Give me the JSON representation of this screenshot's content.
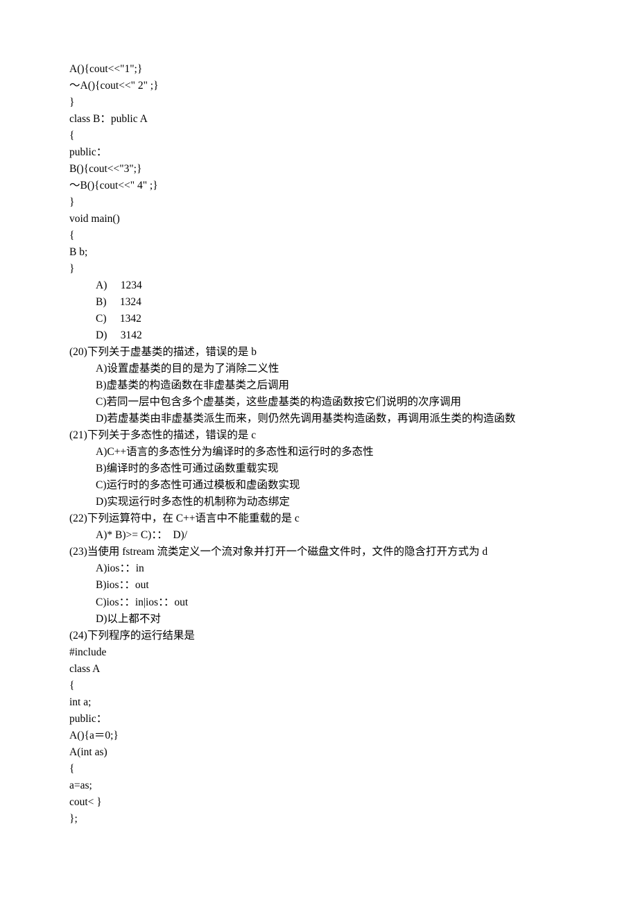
{
  "lines": [
    {
      "cls": "line",
      "t": "A(){cout<<\"1\";}"
    },
    {
      "cls": "line",
      "t": "～A(){cout<<\" 2\" ;}"
    },
    {
      "cls": "line",
      "t": "}"
    },
    {
      "cls": "line",
      "t": "class B：public A"
    },
    {
      "cls": "line",
      "t": "{"
    },
    {
      "cls": "line",
      "t": "public："
    },
    {
      "cls": "line",
      "t": "B(){cout<<\"3\";}"
    },
    {
      "cls": "line",
      "t": "～B(){cout<<\" 4\" ;}"
    },
    {
      "cls": "line",
      "t": "}"
    },
    {
      "cls": "line",
      "t": "void main()"
    },
    {
      "cls": "line",
      "t": "{"
    },
    {
      "cls": "line",
      "t": "B b;"
    },
    {
      "cls": "line",
      "t": "}"
    },
    {
      "cls": "line indent2",
      "t": "A)     1234"
    },
    {
      "cls": "line indent2",
      "t": "B)     1324"
    },
    {
      "cls": "line indent2",
      "t": "C)     1342"
    },
    {
      "cls": "line indent2",
      "t": "D)     3142"
    },
    {
      "cls": "line",
      "t": "(20)下列关于虚基类的描述，错误的是 b"
    },
    {
      "cls": "line indent1",
      "t": "A)设置虚基类的目的是为了消除二义性"
    },
    {
      "cls": "line indent1",
      "t": "B)虚基类的构造函数在非虚基类之后调用"
    },
    {
      "cls": "line indent1",
      "t": "C)若同一层中包含多个虚基类，这些虚基类的构造函数按它们说明的次序调用"
    },
    {
      "cls": "line indent1",
      "t": "D)若虚基类由非虚基类派生而来，则仍然先调用基类构造函数，再调用派生类的构造函数"
    },
    {
      "cls": "line",
      "t": "(21)下列关于多态性的描述，错误的是 c"
    },
    {
      "cls": "line indent1",
      "t": "A)C++语言的多态性分为编译时的多态性和运行时的多态性"
    },
    {
      "cls": "line indent1",
      "t": "B)编译时的多态性可通过函数重载实现"
    },
    {
      "cls": "line indent1",
      "t": "C)运行时的多态性可通过模板和虚函数实现"
    },
    {
      "cls": "line indent1",
      "t": "D)实现运行时多态性的机制称为动态绑定"
    },
    {
      "cls": "line",
      "t": "(22)下列运算符中，在 C++语言中不能重载的是 c"
    },
    {
      "cls": "line indent1",
      "t": "A)* B)>= C)：：  D)/"
    },
    {
      "cls": "line",
      "t": "(23)当使用 fstream 流类定义一个流对象并打开一个磁盘文件时，文件的隐含打开方式为 d"
    },
    {
      "cls": "line indent1",
      "t": "A)ios：：in"
    },
    {
      "cls": "line indent1",
      "t": "B)ios：：out"
    },
    {
      "cls": "line indent1",
      "t": "C)ios：：in|ios：：out"
    },
    {
      "cls": "line indent1",
      "t": "D)以上都不对"
    },
    {
      "cls": "line",
      "t": "(24)下列程序的运行结果是"
    },
    {
      "cls": "line",
      "t": "#include"
    },
    {
      "cls": "line",
      "t": "class A"
    },
    {
      "cls": "line",
      "t": "{"
    },
    {
      "cls": "line",
      "t": "int a;"
    },
    {
      "cls": "line",
      "t": "public："
    },
    {
      "cls": "line",
      "t": "A(){a＝0;}"
    },
    {
      "cls": "line",
      "t": "A(int as)"
    },
    {
      "cls": "line",
      "t": "{"
    },
    {
      "cls": "line",
      "t": "a=as;"
    },
    {
      "cls": "line",
      "t": "cout< }"
    },
    {
      "cls": "line",
      "t": "};"
    }
  ]
}
